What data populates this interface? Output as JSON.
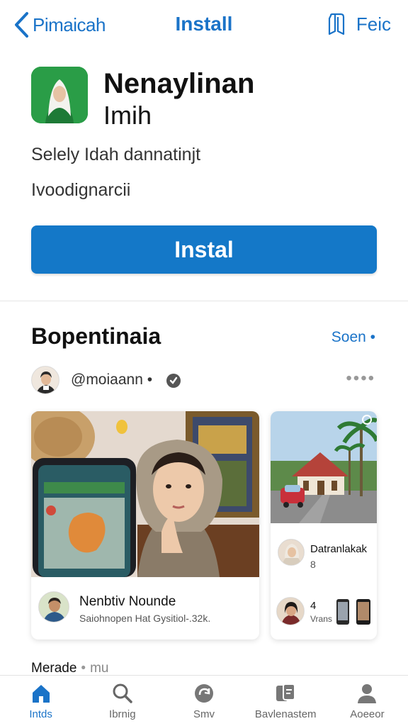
{
  "topbar": {
    "back_label": "Pimaicah",
    "title": "Install",
    "right_label": "Feic"
  },
  "app": {
    "name": "Nenaylinan",
    "subtitle": "Imih",
    "description_line1": "Selely Idah dannatinjt",
    "description_line2": "Ivoodignarcii",
    "install_label": "Instal",
    "icon_color": "#2a9d47"
  },
  "section": {
    "title": "Bopentinaia",
    "see_all": "Soen •"
  },
  "author": {
    "handle": "@moiaann",
    "separator": "•",
    "more": "••••"
  },
  "cards": [
    {
      "title": "Nenbtiv Nounde",
      "meta": "Saiohnopen  Hat  Gysitiol-.32k."
    },
    {
      "title": "Datranlakak",
      "meta": "8",
      "extra_title": "4",
      "extra_meta": "Vrans"
    }
  ],
  "peek": {
    "label": "Merade",
    "separator": "•",
    "more": "mu"
  },
  "tabs": [
    {
      "label": "Intds",
      "icon": "home-icon",
      "active": true
    },
    {
      "label": "Ibrnig",
      "icon": "search-icon",
      "active": false
    },
    {
      "label": "Smv",
      "icon": "refresh-icon",
      "active": false
    },
    {
      "label": "Bavlenastem",
      "icon": "library-icon",
      "active": false
    },
    {
      "label": "Aoeeor",
      "icon": "profile-icon",
      "active": false
    }
  ],
  "colors": {
    "accent": "#1a73c8",
    "install_button": "#1478c8"
  }
}
